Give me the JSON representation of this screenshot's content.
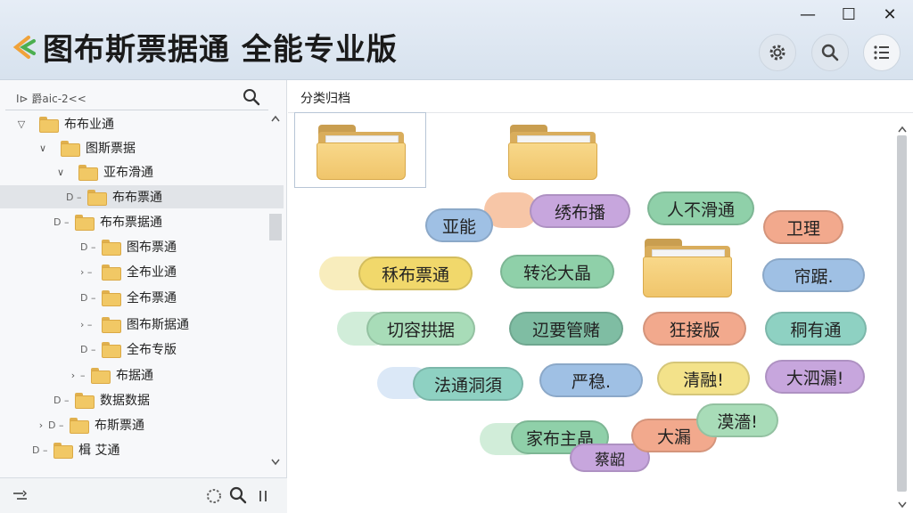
{
  "window": {
    "title": "图布斯票据通   全能专业版",
    "minimize": "—",
    "maximize": "☐",
    "close": "✕"
  },
  "toolbar": {
    "settings_icon": "gear-icon",
    "search_icon": "search-icon",
    "menu_icon": "menu-icon"
  },
  "sidebar": {
    "search_value": "I⊳ 爵aic-2<<",
    "tree": [
      {
        "label": "布布业通",
        "twisty": "▽",
        "dash": ""
      },
      {
        "label": "图斯票据",
        "twisty": "∨",
        "dash": ""
      },
      {
        "label": "亚布滑通",
        "twisty": "∨",
        "dash": ""
      },
      {
        "label": "布布票通",
        "twisty": "",
        "dash": "D –"
      },
      {
        "label": "布布票据通",
        "twisty": "",
        "dash": "D –"
      },
      {
        "label": "图布票通",
        "twisty": "",
        "dash": "D –"
      },
      {
        "label": "全布业通",
        "twisty": "",
        "dash": "›  –"
      },
      {
        "label": "全布票通",
        "twisty": "",
        "dash": "D –"
      },
      {
        "label": "图布斯据通",
        "twisty": "",
        "dash": "›  –"
      },
      {
        "label": "全布专版",
        "twisty": "",
        "dash": "D –"
      },
      {
        "label": "布据通",
        "twisty": "›",
        "dash": "–"
      },
      {
        "label": "数据数据",
        "twisty": "",
        "dash": "D –"
      },
      {
        "label": "布斯票通",
        "twisty": "›",
        "dash": "D –"
      },
      {
        "label": "楫 艾通",
        "twisty": "",
        "dash": "D –"
      }
    ]
  },
  "main": {
    "breadcrumb": "分类归档",
    "tags": [
      {
        "label": "亚能",
        "color": "#9fc0e4"
      },
      {
        "label": "绣布播",
        "color": "#c7a6dd"
      },
      {
        "label": "人不滑通",
        "color": "#8fd0a9"
      },
      {
        "label": "卫理",
        "color": "#f2a98d"
      },
      {
        "label": "秝布票通",
        "color": "#f1d86b"
      },
      {
        "label": "转沦大晶",
        "color": "#8fd0a9"
      },
      {
        "label": "帘踞.",
        "color": "#9fc0e4"
      },
      {
        "label": "切容拱据",
        "color": "#a8dcb8"
      },
      {
        "label": "辺要管赌",
        "color": "#7fbda3"
      },
      {
        "label": "狂接版",
        "color": "#f2a98d"
      },
      {
        "label": "秱有通",
        "color": "#8ed1c2"
      },
      {
        "label": "法通洞須",
        "color": "#8ed1c2"
      },
      {
        "label": "严稳.",
        "color": "#9fc0e4"
      },
      {
        "label": "清融!",
        "color": "#f3e28a"
      },
      {
        "label": "大泗漏!",
        "color": "#c7a6dd"
      },
      {
        "label": "家布主晶",
        "color": "#8fd0a9"
      },
      {
        "label": "大漏",
        "color": "#f2a98d"
      },
      {
        "label": "漠濇!",
        "color": "#a8dcb8"
      },
      {
        "label": "蔡龆",
        "color": "#c7a6dd"
      }
    ]
  }
}
